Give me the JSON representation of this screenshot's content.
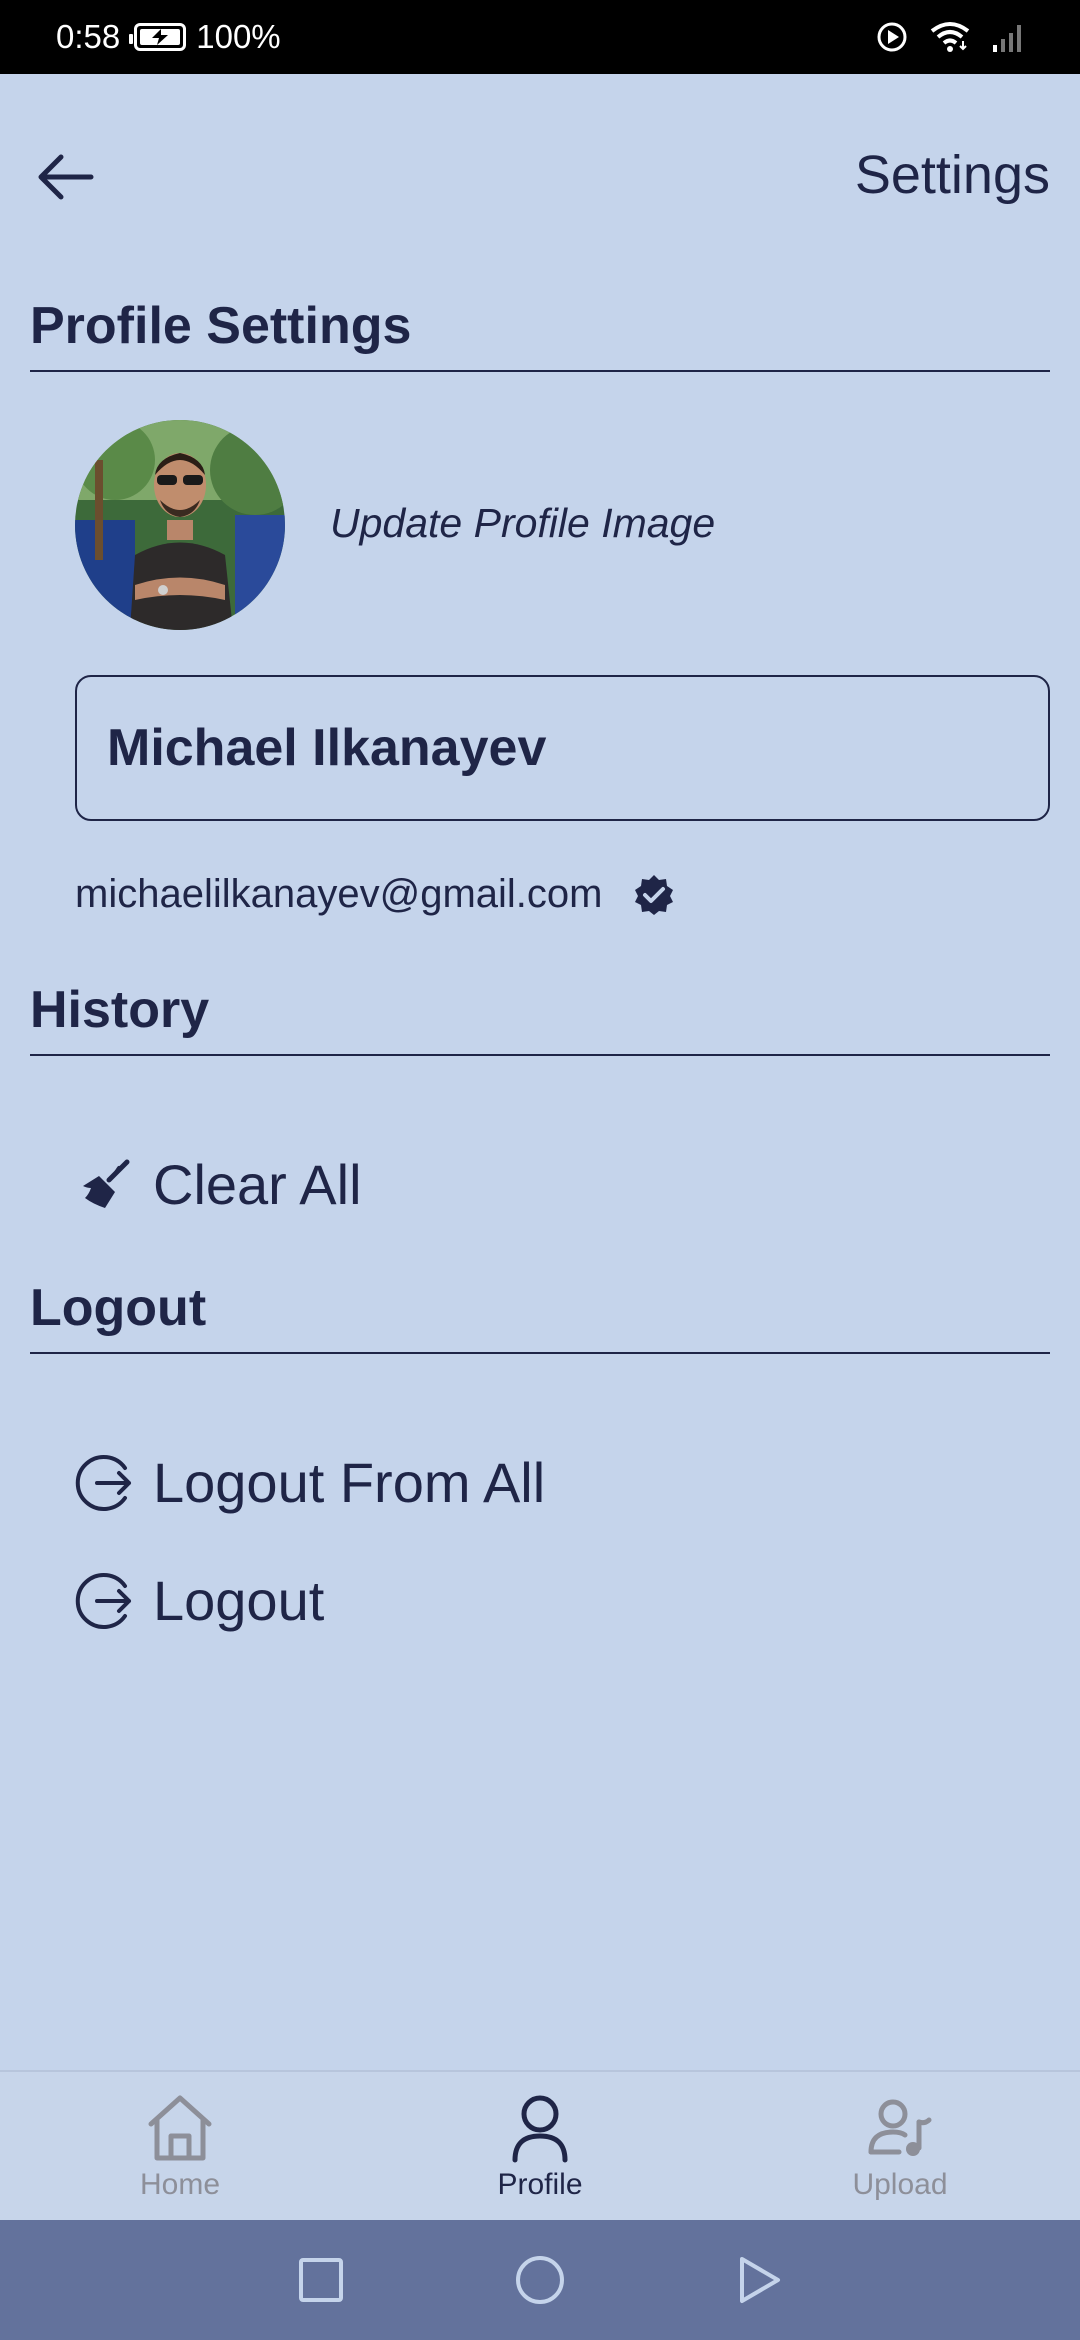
{
  "status_bar": {
    "time": "0:58",
    "battery": "100%"
  },
  "header": {
    "title": "Settings"
  },
  "sections": {
    "profile": "Profile Settings",
    "history": "History",
    "logout": "Logout"
  },
  "profile": {
    "update_image_label": "Update Profile Image",
    "name": "Michael Ilkanayev",
    "email": "michaelilkanayev@gmail.com"
  },
  "history": {
    "clear_all": "Clear All"
  },
  "logout": {
    "logout_all": "Logout From All",
    "logout": "Logout"
  },
  "bottom_nav": {
    "home": "Home",
    "profile": "Profile",
    "upload": "Upload"
  },
  "colors": {
    "background": "#c5d4eb",
    "text": "#1f2547",
    "inactive": "#8d8f99",
    "system_nav": "#63729c"
  }
}
